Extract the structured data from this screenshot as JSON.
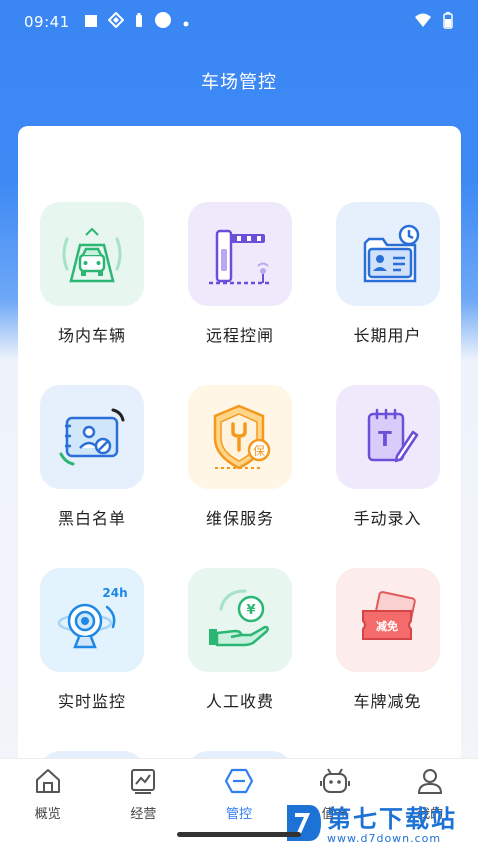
{
  "status": {
    "time": "09:41"
  },
  "header": {
    "title": "车场管控"
  },
  "grid": [
    {
      "label": "场内车辆",
      "icon": "parked-car-icon"
    },
    {
      "label": "远程控闸",
      "icon": "barrier-gate-icon"
    },
    {
      "label": "长期用户",
      "icon": "long-term-user-icon"
    },
    {
      "label": "黑白名单",
      "icon": "blacklist-card-icon"
    },
    {
      "label": "维保服务",
      "icon": "maintenance-shield-icon"
    },
    {
      "label": "手动录入",
      "icon": "manual-entry-icon"
    },
    {
      "label": "实时监控",
      "icon": "camera-24h-icon"
    },
    {
      "label": "人工收费",
      "icon": "manual-charge-icon"
    },
    {
      "label": "车牌减免",
      "icon": "plate-discount-icon"
    }
  ],
  "icon_text": {
    "keep": "保",
    "cam": "24h",
    "coin": "¥",
    "discount": "减免",
    "note": "T"
  },
  "tabs": [
    {
      "label": "概览",
      "icon": "home-icon",
      "active": false
    },
    {
      "label": "经营",
      "icon": "chart-icon",
      "active": false
    },
    {
      "label": "管控",
      "icon": "control-icon",
      "active": true
    },
    {
      "label": "值守",
      "icon": "robot-icon",
      "active": false
    },
    {
      "label": "我的",
      "icon": "user-icon",
      "active": false
    }
  ],
  "watermark": {
    "line1": "第七下载站",
    "line2": "www.d7down.com"
  },
  "colors": {
    "accent": "#2f7ef2",
    "header_bg": "#3a86f3"
  }
}
